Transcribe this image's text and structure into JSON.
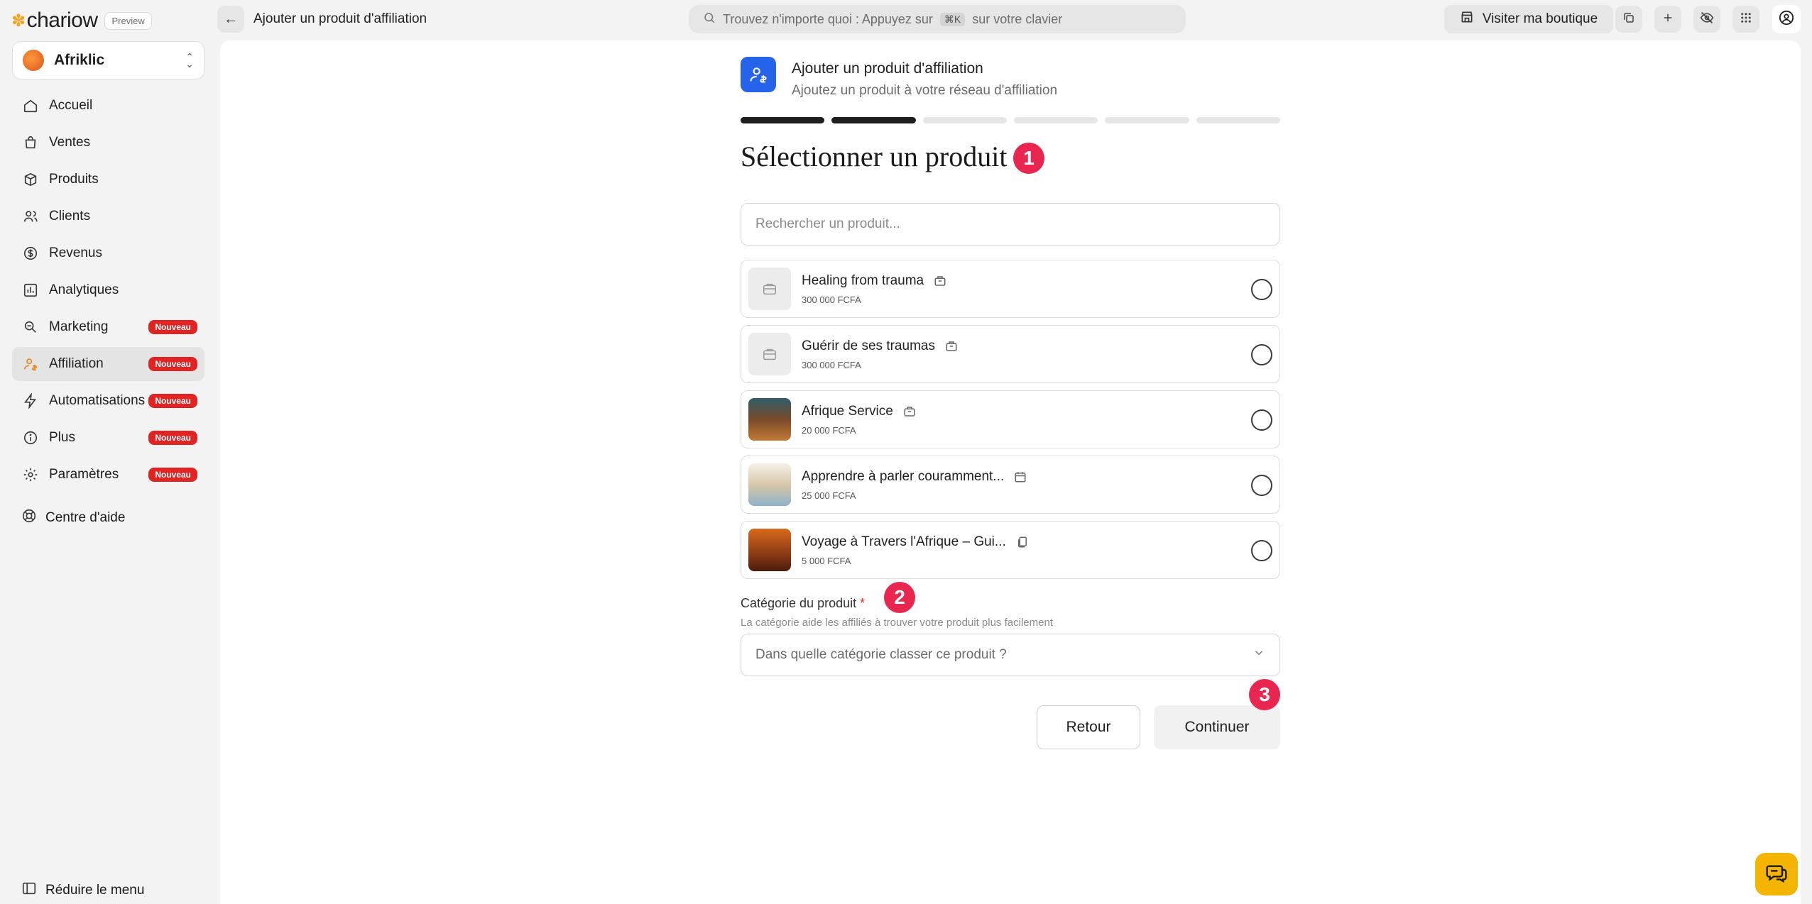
{
  "brand": {
    "name": "chariow",
    "preview": "Preview"
  },
  "topbar": {
    "crumb": "Ajouter un produit d'affiliation",
    "search_prefix": "Trouvez n'importe quoi : Appuyez sur",
    "search_kbd": "⌘K",
    "search_suffix": "sur votre clavier",
    "visit_label": "Visiter ma boutique"
  },
  "shop": {
    "name": "Afriklic"
  },
  "sidebar": {
    "items": [
      {
        "label": "Accueil",
        "icon": "home-icon"
      },
      {
        "label": "Ventes",
        "icon": "cart-icon"
      },
      {
        "label": "Produits",
        "icon": "box-icon"
      },
      {
        "label": "Clients",
        "icon": "users-icon"
      },
      {
        "label": "Revenus",
        "icon": "revenue-icon"
      },
      {
        "label": "Analytiques",
        "icon": "chart-icon"
      },
      {
        "label": "Marketing",
        "icon": "marketing-icon",
        "badge": "Nouveau"
      },
      {
        "label": "Affiliation",
        "icon": "affiliation-icon",
        "badge": "Nouveau",
        "active": true
      },
      {
        "label": "Automatisations",
        "icon": "bolt-icon",
        "badge": "Nouveau"
      },
      {
        "label": "Plus",
        "icon": "info-icon",
        "badge": "Nouveau"
      },
      {
        "label": "Paramètres",
        "icon": "gear-icon",
        "badge": "Nouveau"
      }
    ],
    "help": "Centre d'aide",
    "collapse": "Réduire le menu"
  },
  "form": {
    "header_title": "Ajouter un produit d'affiliation",
    "header_subtitle": "Ajoutez un produit à votre réseau d'affiliation",
    "steps_total": 6,
    "steps_done": 2,
    "title": "Sélectionner un produit",
    "search_placeholder": "Rechercher un produit...",
    "products": [
      {
        "name": "Healing from trauma",
        "price": "300 000 FCFA"
      },
      {
        "name": "Guérir de ses traumas",
        "price": "300 000 FCFA"
      },
      {
        "name": "Afrique Service",
        "price": "20 000 FCFA"
      },
      {
        "name": "Apprendre à parler couramment...",
        "price": "25 000 FCFA"
      },
      {
        "name": "Voyage à Travers l'Afrique – Gui...",
        "price": "5 000 FCFA"
      }
    ],
    "category_label": "Catégorie du produit",
    "category_required": "*",
    "category_help": "La catégorie aide les affiliés à trouver votre produit plus facilement",
    "category_placeholder": "Dans quelle catégorie classer ce produit ?",
    "back_label": "Retour",
    "continue_label": "Continuer"
  },
  "markers": {
    "one": "1",
    "two": "2",
    "three": "3"
  },
  "colors": {
    "accent": "#2563eb",
    "badge": "#e02424",
    "marker": "#e8264f",
    "fab": "#f5b400"
  }
}
